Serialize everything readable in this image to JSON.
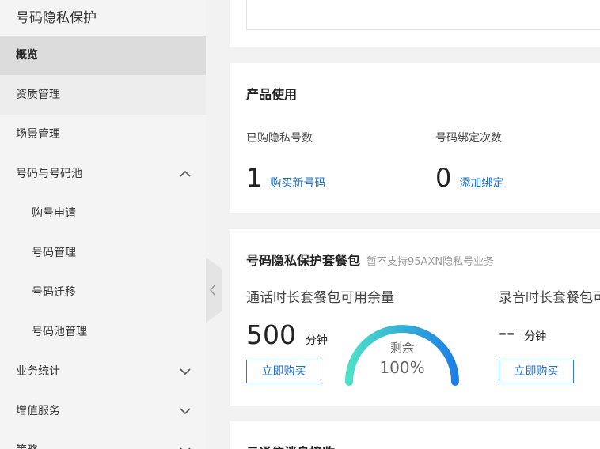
{
  "sidebar": {
    "title": "号码隐私保护",
    "items": [
      {
        "label": "概览"
      },
      {
        "label": "资质管理"
      },
      {
        "label": "场景管理"
      },
      {
        "label": "号码与号码池"
      },
      {
        "label": "购号申请"
      },
      {
        "label": "号码管理"
      },
      {
        "label": "号码迁移"
      },
      {
        "label": "号码池管理"
      },
      {
        "label": "业务统计"
      },
      {
        "label": "增值服务"
      },
      {
        "label": "策略"
      }
    ]
  },
  "usage": {
    "title": "产品使用",
    "purchased_label": "已购隐私号数",
    "purchased_value": "1",
    "purchased_link": "购买新号码",
    "binding_label": "号码绑定次数",
    "binding_value": "0",
    "binding_link": "添加绑定"
  },
  "package": {
    "title": "号码隐私保护套餐包",
    "subtitle": "暂不支持95AXN隐私号业务",
    "call_label": "通话时长套餐包可用余量",
    "call_value": "500",
    "call_unit": "分钟",
    "call_buy": "立即购买",
    "gauge_label": "剩余",
    "gauge_percent": "100%",
    "gauge_fraction": 1.0,
    "record_label": "录音时长套餐包可",
    "record_value": "--",
    "record_unit": "分钟",
    "record_buy": "立即购买"
  },
  "bottom": {
    "title": "云通信消息接收"
  }
}
